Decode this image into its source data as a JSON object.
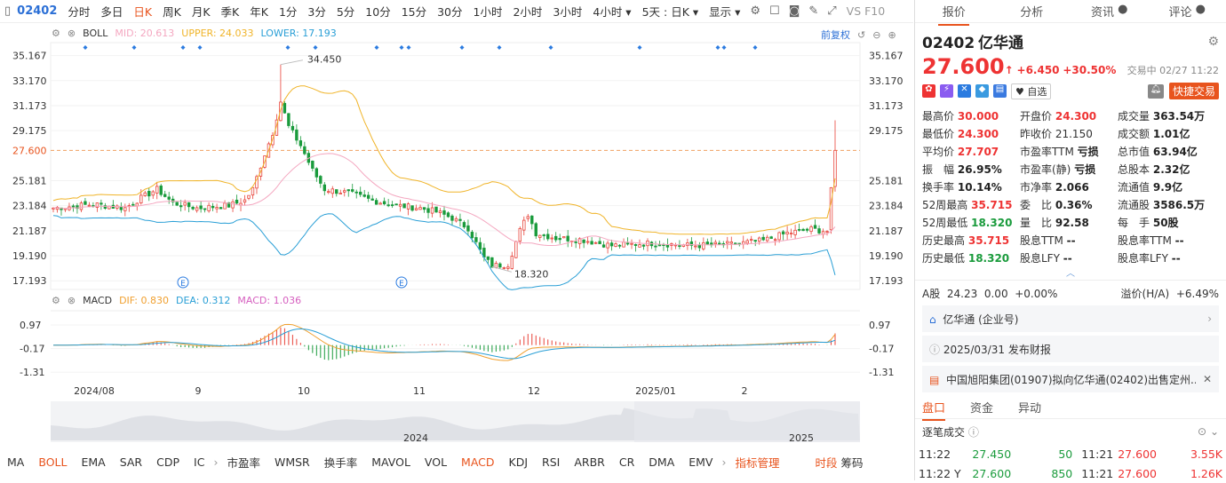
{
  "toolbar": {
    "code": "02402",
    "periods": [
      "分时",
      "多日",
      "日K",
      "周K",
      "月K",
      "季K",
      "年K",
      "1分",
      "3分",
      "5分",
      "10分",
      "15分",
      "30分",
      "1小时",
      "2小时",
      "3小时",
      "4小时 ▾",
      "5天 : 日K ▾"
    ],
    "active": "日K",
    "display": "显示 ▾",
    "vs": "VS F10"
  },
  "boll": {
    "name": "BOLL",
    "mid": "MID: 20.613",
    "upper": "UPPER: 24.033",
    "lower": "LOWER: 17.193",
    "adjust": "前复权",
    "mid_color": "#f4a7c0",
    "upper_color": "#f0b429",
    "lower_color": "#2a9fd6"
  },
  "macd": {
    "name": "MACD",
    "dif": "DIF: 0.830",
    "dea": "DEA: 0.312",
    "macd": "MACD: 1.036",
    "dif_color": "#f0a030",
    "dea_color": "#2a9fd6",
    "macd_color": "#d660c0"
  },
  "axis": {
    "left_prices": [
      "35.167",
      "33.170",
      "31.173",
      "29.175",
      "27.600",
      "25.181",
      "23.184",
      "21.187",
      "19.190",
      "17.193"
    ],
    "right_prices": [
      "35.167",
      "33.170",
      "31.173",
      "29.175",
      "27.600",
      "25.181",
      "23.184",
      "21.187",
      "19.190",
      "17.193"
    ],
    "macd_ticks": [
      "0.97",
      "-0.17",
      "-1.31"
    ],
    "dates": [
      "2024/08",
      "9",
      "10",
      "11",
      "12",
      "2025/01",
      "2"
    ],
    "overview_years": [
      "2024",
      "2025"
    ],
    "high_label": "34.450",
    "low_label": "18.320",
    "current": "27.600"
  },
  "bottom": {
    "items": [
      "MA",
      "BOLL",
      "EMA",
      "SAR",
      "CDP",
      "IC"
    ],
    "active": "BOLL",
    "items2": [
      "市盈率",
      "WMSR",
      "换手率",
      "MAVOL",
      "VOL",
      "MACD",
      "KDJ",
      "RSI",
      "ARBR",
      "CR",
      "DMA",
      "EMV"
    ],
    "active2": "MACD",
    "manage": "指标管理",
    "time": "时段",
    "chips": "筹码"
  },
  "right": {
    "tabs": [
      "报价",
      "分析",
      "资讯",
      "评论"
    ],
    "code": "02402",
    "name": "亿华通",
    "price": "27.600",
    "change": "+6.450",
    "pct": "+30.50%",
    "status": "交易中 02/27 11:22",
    "watch": "自选",
    "trade": "快捷交易",
    "stats": [
      [
        "最高价",
        "30.000",
        "r",
        "开盘价",
        "24.300",
        "r",
        "成交量",
        "363.54万",
        "k"
      ],
      [
        "最低价",
        "24.300",
        "r",
        "昨收价",
        "21.150",
        "n",
        "成交额",
        "1.01亿",
        "k"
      ],
      [
        "平均价",
        "27.707",
        "r",
        "市盈率TTM",
        "亏损",
        "k",
        "总市值",
        "63.94亿",
        "k"
      ],
      [
        "振　幅",
        "26.95%",
        "k",
        "市盈率(静)",
        "亏损",
        "k",
        "总股本",
        "2.32亿",
        "k"
      ],
      [
        "换手率",
        "10.14%",
        "k",
        "市净率",
        "2.066",
        "k",
        "流通值",
        "9.9亿",
        "k"
      ],
      [
        "52周最高",
        "35.715",
        "r",
        "委　比",
        "0.36%",
        "k",
        "流通股",
        "3586.5万",
        "k"
      ],
      [
        "52周最低",
        "18.320",
        "g",
        "量　比",
        "92.58",
        "k",
        "每　手",
        "50股",
        "k"
      ],
      [
        "历史最高",
        "35.715",
        "r",
        "股息TTM",
        "--",
        "k",
        "股息率TTM",
        "--",
        "k"
      ],
      [
        "历史最低",
        "18.320",
        "g",
        "股息LFY",
        "--",
        "k",
        "股息率LFY",
        "--",
        "k"
      ]
    ],
    "ashare": "A股",
    "ashare_price": "24.23",
    "ashare_chg": "0.00",
    "ashare_pct": "+0.00%",
    "premium_label": "溢价(H/A)",
    "premium": "+6.49%",
    "company": "亿华通 (企业号)",
    "report": "2025/03/31  发布财报",
    "news": "中国旭阳集团(01907)拟向亿华通(02402)出售定州...",
    "btabs": [
      "盘口",
      "资金",
      "异动"
    ],
    "trades_title": "逐笔成交",
    "trades": [
      [
        "11:22",
        "27.450",
        "50",
        "11:21",
        "27.600",
        "3.55K"
      ],
      [
        "11:22 Y",
        "27.600",
        "850",
        "11:21",
        "27.600",
        "1.26K"
      ]
    ]
  }
}
